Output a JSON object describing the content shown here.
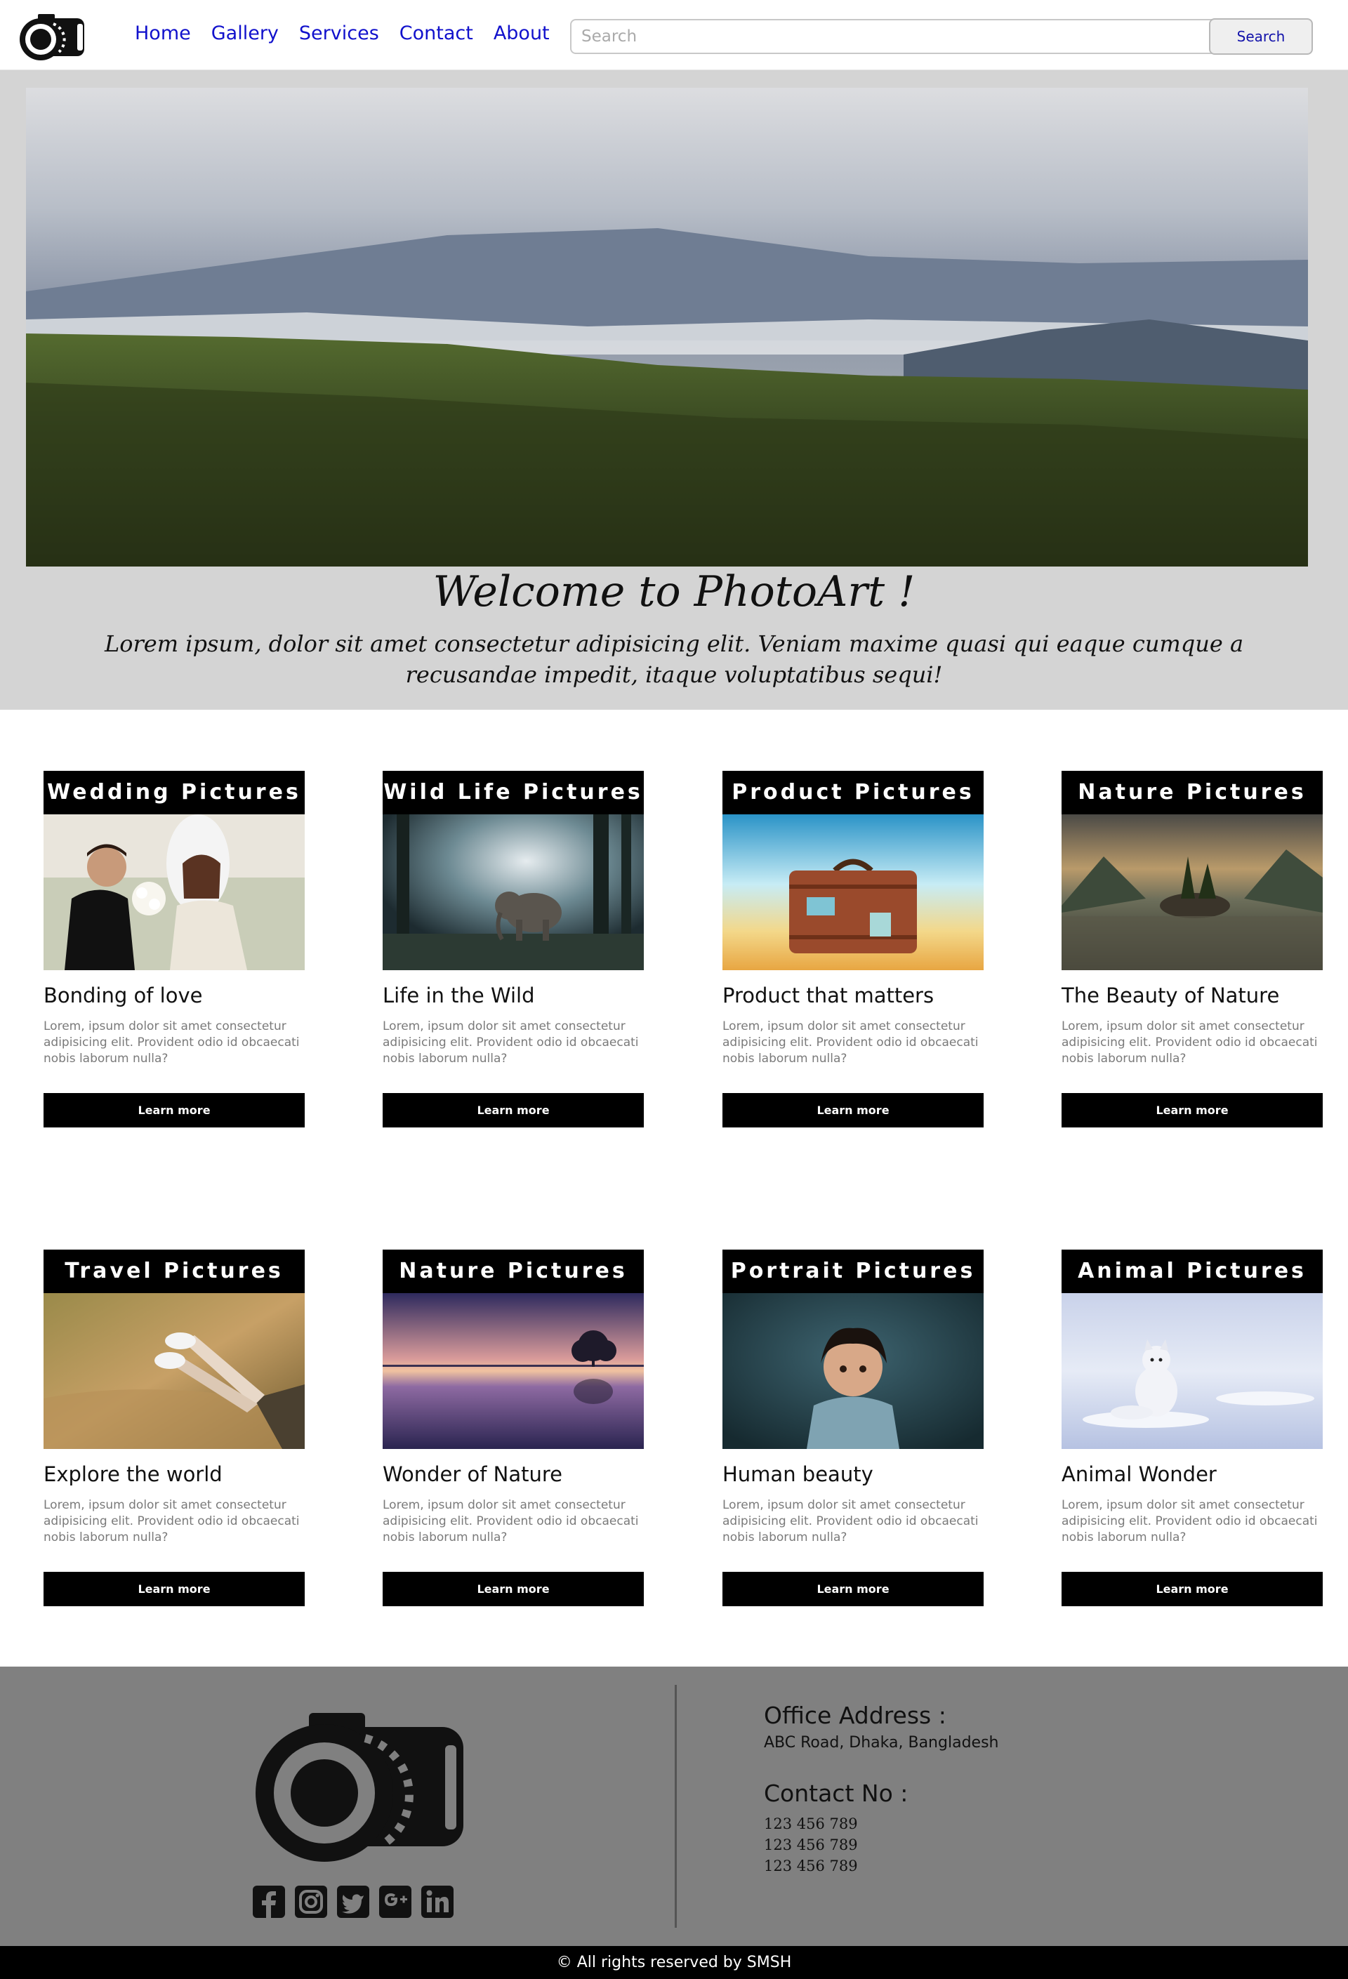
{
  "nav": {
    "links": [
      "Home",
      "Gallery",
      "Services",
      "Contact",
      "About"
    ],
    "search_placeholder": "Search",
    "search_button": "Search"
  },
  "hero": {
    "title": "Welcome to PhotoArt !",
    "text": "Lorem ipsum, dolor sit amet consectetur adipisicing elit. Veniam maxime quasi qui eaque cumque a recusandae impedit, itaque voluptatibus sequi!"
  },
  "cards": [
    {
      "header": "Wedding Pictures",
      "title": "Bonding of love",
      "text": "Lorem, ipsum dolor sit amet consectetur adipisicing elit. Provident odio id obcaecati nobis laborum nulla?",
      "button": "Learn more"
    },
    {
      "header": "Wild Life Pictures",
      "title": "Life in the Wild",
      "text": "Lorem, ipsum dolor sit amet consectetur adipisicing elit. Provident odio id obcaecati nobis laborum nulla?",
      "button": "Learn more"
    },
    {
      "header": "Product Pictures",
      "title": "Product that matters",
      "text": "Lorem, ipsum dolor sit amet consectetur adipisicing elit. Provident odio id obcaecati nobis laborum nulla?",
      "button": "Learn more"
    },
    {
      "header": "Nature Pictures",
      "title": "The Beauty of Nature",
      "text": "Lorem, ipsum dolor sit amet consectetur adipisicing elit. Provident odio id obcaecati nobis laborum nulla?",
      "button": "Learn more"
    },
    {
      "header": "Travel Pictures",
      "title": "Explore the world",
      "text": "Lorem, ipsum dolor sit amet consectetur adipisicing elit. Provident odio id obcaecati nobis laborum nulla?",
      "button": "Learn more"
    },
    {
      "header": "Nature Pictures",
      "title": "Wonder of Nature",
      "text": "Lorem, ipsum dolor sit amet consectetur adipisicing elit. Provident odio id obcaecati nobis laborum nulla?",
      "button": "Learn more"
    },
    {
      "header": "Portrait Pictures",
      "title": "Human beauty",
      "text": "Lorem, ipsum dolor sit amet consectetur adipisicing elit. Provident odio id obcaecati nobis laborum nulla?",
      "button": "Learn more"
    },
    {
      "header": "Animal Pictures",
      "title": "Animal Wonder",
      "text": "Lorem, ipsum dolor sit amet consectetur adipisicing elit. Provident odio id obcaecati nobis laborum nulla?",
      "button": "Learn more"
    }
  ],
  "footer": {
    "office_heading": "Office Address :",
    "office_address": "ABC Road, Dhaka, Bangladesh",
    "contact_heading": "Contact No :",
    "phones": [
      "123 456 789",
      "123 456 789",
      "123 456 789"
    ],
    "social_icons": [
      "facebook-icon",
      "instagram-icon",
      "twitter-icon",
      "google-plus-icon",
      "linkedin-icon"
    ],
    "copyright": "© All rights reserved by SMSH"
  },
  "colors": {
    "nav_link": "#1111cc",
    "hero_bg": "#d4d4d4",
    "footer_bg": "#808080",
    "card_header_bg": "#000000",
    "bottom_bar_bg": "#000000"
  }
}
